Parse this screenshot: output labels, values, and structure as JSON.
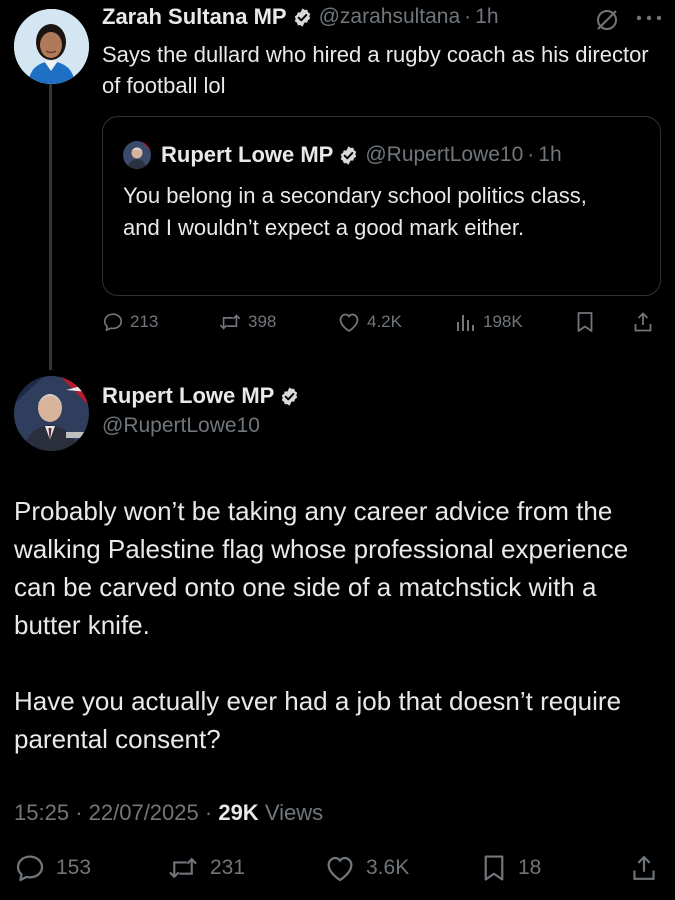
{
  "parent_tweet": {
    "author_name": "Zarah Sultana MP",
    "handle": "@zarahsultana",
    "time": "1h",
    "text": "Says the dullard who hired a rugby coach as his director of football lol",
    "quoted": {
      "author_name": "Rupert Lowe MP",
      "handle": "@RupertLowe10",
      "time": "1h",
      "text": "You belong in a secondary school politics class, and I wouldn’t expect a good mark either."
    },
    "stats": {
      "replies": "213",
      "reposts": "398",
      "likes": "4.2K",
      "views": "198K"
    }
  },
  "main_tweet": {
    "author_name": "Rupert Lowe MP",
    "handle": "@RupertLowe10",
    "paragraph_1": "Probably won’t be taking any career advice from the walking Palestine flag whose professional experience can be carved onto one side of a matchstick with a butter knife.",
    "paragraph_2": "Have you actually ever had a job that doesn’t require parental consent?",
    "time": "15:25",
    "date": "22/07/2025",
    "views_count": "29K",
    "views_label": "Views",
    "stats": {
      "replies": "153",
      "reposts": "231",
      "likes": "3.6K",
      "bookmarks": "18"
    }
  },
  "colors": {
    "background": "#000000",
    "text_primary": "#e7e9ea",
    "text_secondary": "#71767b",
    "verified_blue": "#1d9bf0",
    "border": "#2f3336"
  },
  "icons": [
    "verified-badge-icon",
    "grok-icon",
    "more-icon",
    "reply-icon",
    "repost-icon",
    "like-icon",
    "views-icon",
    "bookmark-icon",
    "share-icon"
  ]
}
